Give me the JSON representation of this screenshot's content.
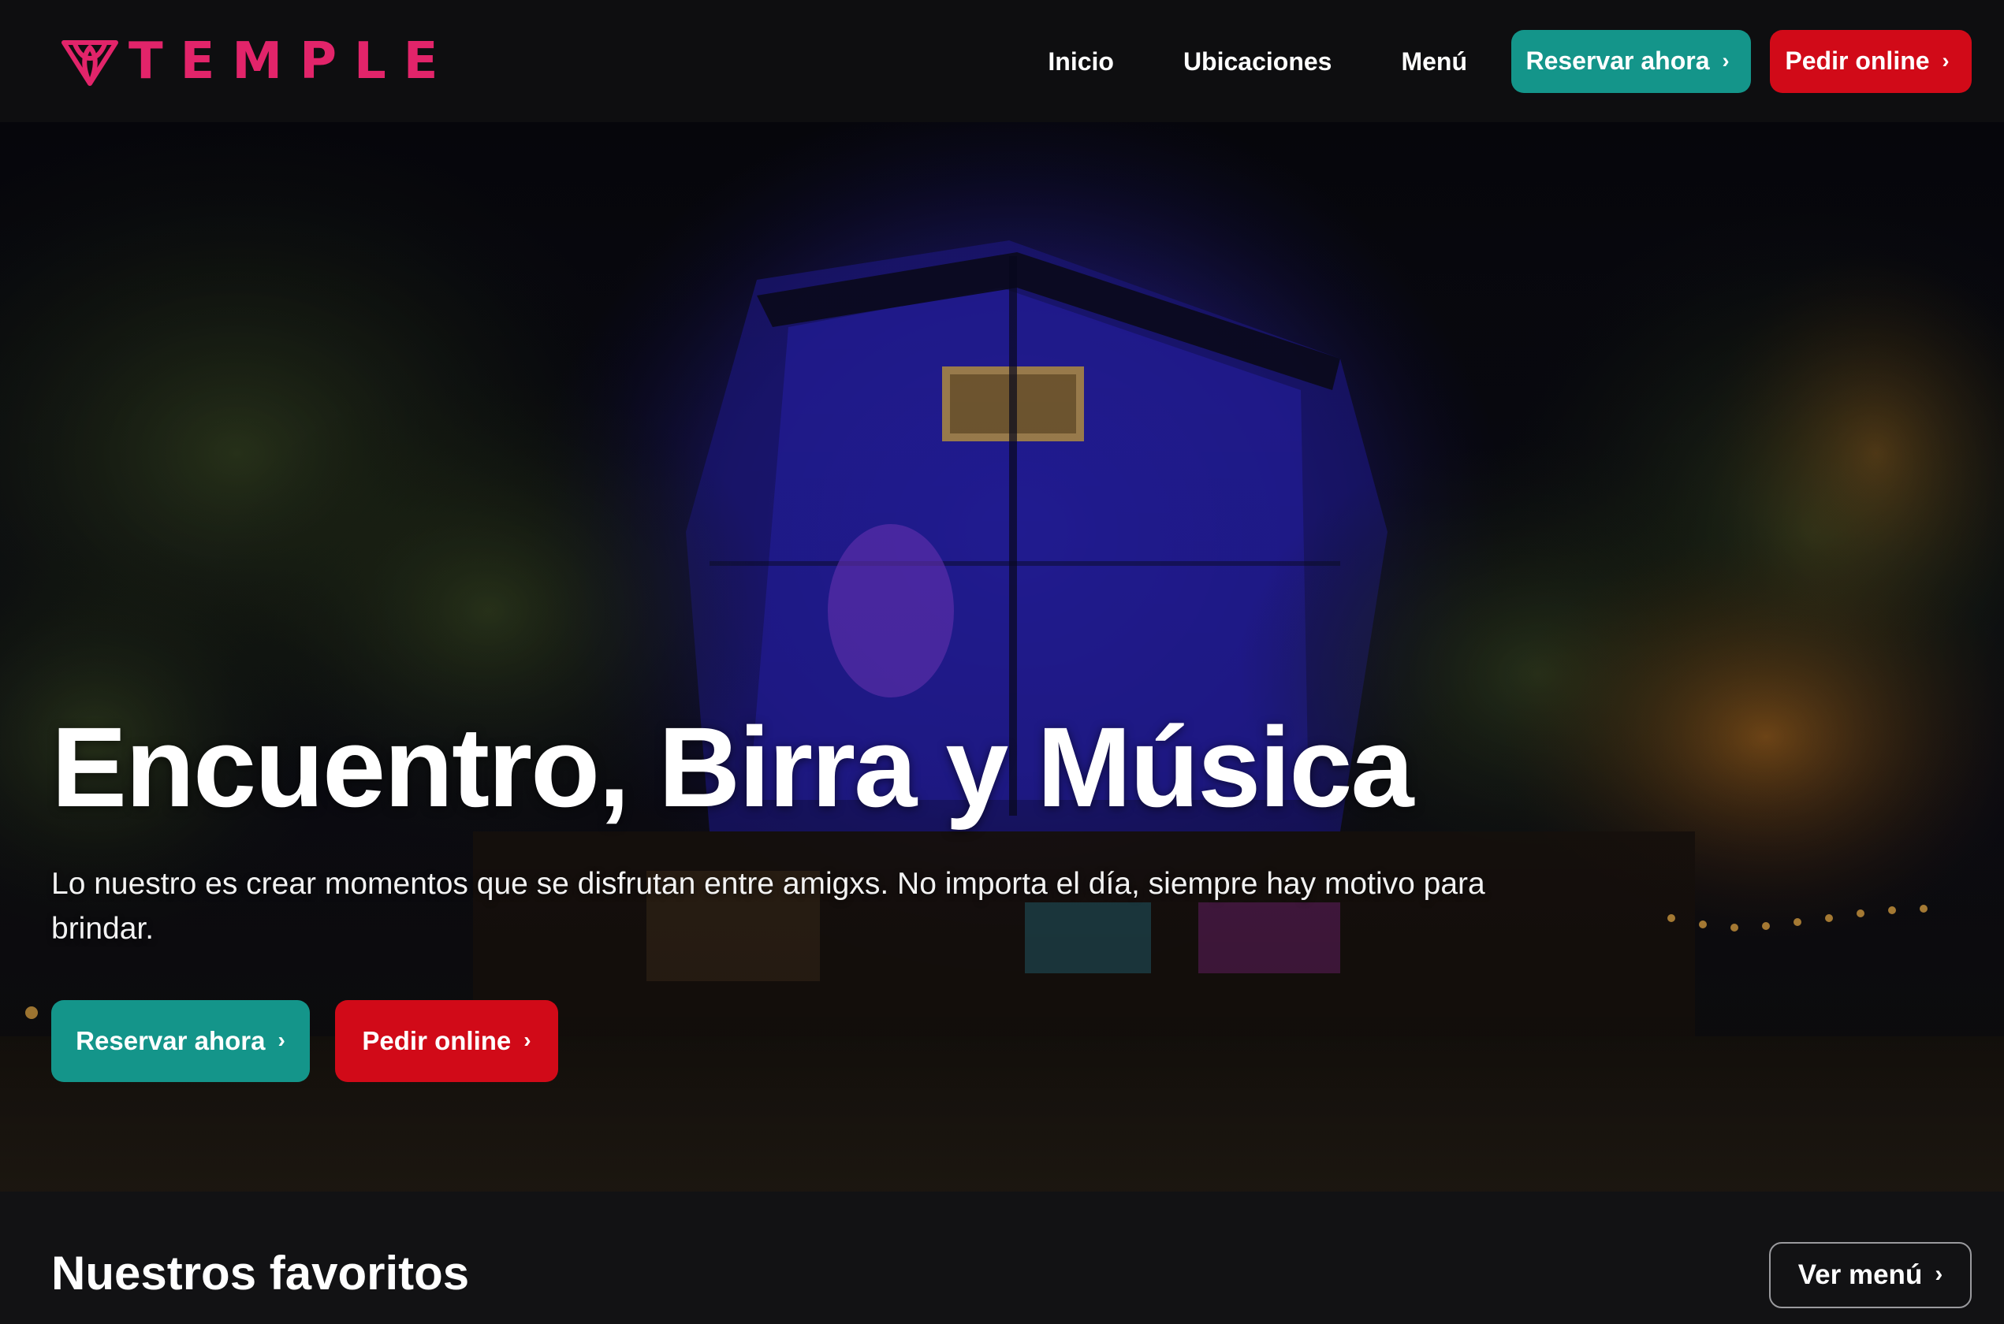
{
  "brand": {
    "name": "TEMPLE",
    "icon": "temple-logo-icon",
    "color": "#e2246a"
  },
  "nav": {
    "links": [
      "Inicio",
      "Ubicaciones",
      "Menú"
    ],
    "reserve_label": "Reservar ahora",
    "order_label": "Pedir online"
  },
  "hero": {
    "title": "Encuentro, Birra y Música",
    "subtitle": "Lo nuestro es crear momentos que se disfrutan entre amigxs. No importa el día, siempre hay motivo para brindar.",
    "reserve_label": "Reservar ahora",
    "order_label": "Pedir online"
  },
  "favorites": {
    "title": "Nuestros favoritos",
    "menu_label": "Ver menú"
  },
  "colors": {
    "accent_teal": "#14958a",
    "accent_red": "#d10a18",
    "brand_pink": "#e2246a",
    "header_bg": "#0e0e10"
  },
  "icons": {
    "chevron": "chevron-right-icon"
  }
}
